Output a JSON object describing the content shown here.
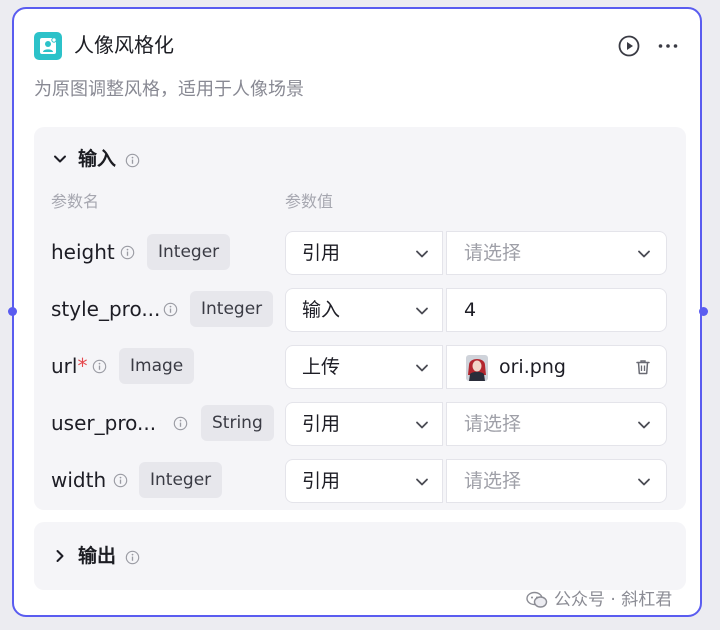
{
  "node": {
    "title": "人像风格化",
    "description": "为原图调整风格，适用于人像场景",
    "icon": "user-portrait-icon",
    "accent_color": "#5a5cf0",
    "icon_bg_color": "#2cc2c9"
  },
  "input_section": {
    "title": "输入",
    "expanded": true,
    "col_name": "参数名",
    "col_value": "参数值",
    "params": [
      {
        "name": "height",
        "required": false,
        "type": "Integer",
        "source": "引用",
        "value": "",
        "placeholder": "请选择"
      },
      {
        "name": "style_pro...",
        "required": false,
        "type": "Integer",
        "source": "输入",
        "value": "4",
        "placeholder": ""
      },
      {
        "name": "url",
        "required": true,
        "type": "Image",
        "source": "上传",
        "value": "ori.png",
        "placeholder": ""
      },
      {
        "name": "user_pro...",
        "required": false,
        "type": "String",
        "source": "引用",
        "value": "",
        "placeholder": "请选择"
      },
      {
        "name": "width",
        "required": false,
        "type": "Integer",
        "source": "引用",
        "value": "",
        "placeholder": "请选择"
      }
    ],
    "required_mark": "*"
  },
  "output_section": {
    "title": "输出",
    "expanded": false
  },
  "watermark": "公众号 · 斜杠君"
}
